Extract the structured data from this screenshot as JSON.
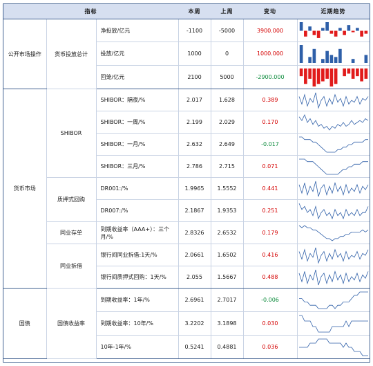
{
  "header": {
    "indicator": "指标",
    "this_week": "本周",
    "last_week": "上周",
    "change": "变动",
    "trend": "近期趋势"
  },
  "groups": [
    {
      "name": "公开市场操作",
      "subgroups": [
        {
          "name": "货币投放总计",
          "rows": [
            0,
            1,
            2
          ]
        }
      ]
    },
    {
      "name": "货币市场",
      "subgroups": [
        {
          "name": "SHIBOR",
          "rows": [
            3,
            4,
            5,
            6
          ]
        },
        {
          "name": "质押式回购",
          "rows": [
            7,
            8
          ]
        },
        {
          "name": "同业存单",
          "rows": [
            9
          ]
        },
        {
          "name": "同业拆借",
          "rows": [
            10,
            11
          ]
        }
      ]
    },
    {
      "name": "国债",
      "subgroups": [
        {
          "name": "国债收益率",
          "rows": [
            12,
            13,
            14
          ]
        }
      ]
    }
  ],
  "rows": [
    {
      "indicator": "净投放/亿元",
      "this_week": "-1100",
      "last_week": "-5000",
      "change": "3900.000",
      "sign": "pos",
      "trend_type": "bar",
      "trend": [
        6,
        -4,
        3,
        -3,
        -5,
        2,
        6,
        -2,
        -4,
        2,
        -3,
        4,
        -1,
        2,
        -4,
        -2
      ]
    },
    {
      "indicator": "投放/亿元",
      "this_week": "1000",
      "last_week": "0",
      "change": "1000.000",
      "sign": "pos",
      "trend_type": "bar",
      "trend": [
        9,
        0,
        3,
        7,
        0,
        2,
        6,
        4,
        3,
        7,
        0,
        0,
        2,
        0,
        0,
        4
      ]
    },
    {
      "indicator": "回笼/亿元",
      "this_week": "2100",
      "last_week": "5000",
      "change": "-2900.000",
      "sign": "neg",
      "trend_type": "bar",
      "trend": [
        -3,
        -6,
        -4,
        -7,
        -6,
        -5,
        -4,
        -7,
        -6,
        0,
        -3,
        -2,
        -4,
        -3,
        -5,
        -4
      ]
    },
    {
      "indicator": "SHIBOR：隔夜/%",
      "this_week": "2.017",
      "last_week": "1.628",
      "change": "0.389",
      "sign": "pos",
      "trend_type": "line",
      "trend": [
        2.0,
        1.6,
        2.1,
        1.5,
        1.9,
        1.7,
        2.2,
        1.4,
        1.8,
        2.0,
        1.5,
        1.9,
        1.6,
        2.1,
        1.7,
        1.9,
        1.5,
        2.0,
        1.6,
        1.8,
        1.7,
        2.0,
        1.6,
        1.9,
        1.8,
        2.0
      ]
    },
    {
      "indicator": "SHIBOR：一周/%",
      "this_week": "2.199",
      "last_week": "2.029",
      "change": "0.170",
      "sign": "pos",
      "trend_type": "line",
      "trend": [
        2.3,
        2.1,
        2.4,
        2.0,
        2.2,
        1.9,
        2.1,
        1.8,
        1.9,
        1.7,
        1.8,
        1.6,
        1.8,
        1.7,
        1.9,
        1.8,
        2.0,
        1.8,
        1.9,
        2.1,
        1.9,
        2.0,
        2.1,
        2.0,
        2.2,
        2.1
      ]
    },
    {
      "indicator": "SHIBOR：一月/%",
      "this_week": "2.632",
      "last_week": "2.649",
      "change": "-0.017",
      "sign": "neg",
      "trend_type": "line",
      "trend": [
        2.8,
        2.8,
        2.7,
        2.7,
        2.7,
        2.6,
        2.6,
        2.5,
        2.4,
        2.3,
        2.2,
        2.2,
        2.2,
        2.2,
        2.3,
        2.3,
        2.4,
        2.4,
        2.5,
        2.5,
        2.6,
        2.6,
        2.6,
        2.6,
        2.7,
        2.7
      ]
    },
    {
      "indicator": "SHIBOR：三月/%",
      "this_week": "2.786",
      "last_week": "2.715",
      "change": "0.071",
      "sign": "pos",
      "trend_type": "line",
      "trend": [
        2.9,
        2.9,
        2.9,
        2.8,
        2.8,
        2.8,
        2.7,
        2.6,
        2.5,
        2.4,
        2.3,
        2.3,
        2.3,
        2.3,
        2.3,
        2.4,
        2.5,
        2.5,
        2.6,
        2.6,
        2.7,
        2.7,
        2.7,
        2.8,
        2.8,
        2.8
      ]
    },
    {
      "indicator": "DR001:/%",
      "this_week": "1.9965",
      "last_week": "1.5552",
      "change": "0.441",
      "sign": "pos",
      "trend_type": "line",
      "trend": [
        2.0,
        1.5,
        2.1,
        1.4,
        1.9,
        1.6,
        2.2,
        1.3,
        1.8,
        2.0,
        1.4,
        1.9,
        1.5,
        2.1,
        1.6,
        1.9,
        1.4,
        2.0,
        1.5,
        1.8,
        1.6,
        2.0,
        1.5,
        1.9,
        1.7,
        2.0
      ]
    },
    {
      "indicator": "DR007:/%",
      "this_week": "2.1867",
      "last_week": "1.9353",
      "change": "0.251",
      "sign": "pos",
      "trend_type": "line",
      "trend": [
        2.3,
        2.1,
        2.2,
        2.0,
        2.1,
        1.9,
        2.2,
        1.8,
        2.0,
        2.1,
        1.9,
        2.0,
        1.8,
        2.1,
        1.9,
        2.0,
        1.8,
        2.1,
        1.9,
        2.0,
        1.9,
        2.1,
        1.9,
        2.0,
        2.0,
        2.2
      ]
    },
    {
      "indicator": "到期收益率（AAA+）：三个月/%",
      "this_week": "2.8326",
      "last_week": "2.6532",
      "change": "0.179",
      "sign": "pos",
      "trend_type": "line",
      "trend": [
        3.0,
        2.9,
        3.0,
        2.9,
        2.9,
        2.8,
        2.8,
        2.7,
        2.6,
        2.5,
        2.4,
        2.4,
        2.3,
        2.4,
        2.4,
        2.5,
        2.5,
        2.6,
        2.6,
        2.7,
        2.7,
        2.7,
        2.7,
        2.8,
        2.7,
        2.8
      ]
    },
    {
      "indicator": "银行间同业拆借:1天/%",
      "this_week": "2.0661",
      "last_week": "1.6502",
      "change": "0.416",
      "sign": "pos",
      "trend_type": "line",
      "trend": [
        2.0,
        1.6,
        2.1,
        1.5,
        1.9,
        1.7,
        2.2,
        1.4,
        1.8,
        2.0,
        1.5,
        1.9,
        1.6,
        2.1,
        1.7,
        1.9,
        1.5,
        2.0,
        1.6,
        1.8,
        1.7,
        2.0,
        1.6,
        1.9,
        1.8,
        2.1
      ]
    },
    {
      "indicator": "银行间质押式回购：1天/%",
      "this_week": "2.055",
      "last_week": "1.5667",
      "change": "0.488",
      "sign": "pos",
      "trend_type": "line",
      "trend": [
        2.0,
        1.5,
        2.1,
        1.4,
        1.9,
        1.6,
        2.2,
        1.3,
        1.8,
        2.0,
        1.4,
        1.9,
        1.5,
        2.1,
        1.6,
        1.9,
        1.4,
        2.0,
        1.5,
        1.8,
        1.6,
        2.0,
        1.5,
        1.9,
        1.7,
        2.1
      ]
    },
    {
      "indicator": "到期收益率：1年/%",
      "this_week": "2.6961",
      "last_week": "2.7017",
      "change": "-0.006",
      "sign": "neg",
      "trend_type": "line",
      "trend": [
        2.5,
        2.5,
        2.4,
        2.4,
        2.3,
        2.3,
        2.3,
        2.2,
        2.2,
        2.2,
        2.2,
        2.3,
        2.3,
        2.2,
        2.3,
        2.3,
        2.4,
        2.4,
        2.4,
        2.5,
        2.6,
        2.6,
        2.7,
        2.7,
        2.7,
        2.7
      ]
    },
    {
      "indicator": "到期收益率：10年/%",
      "this_week": "3.2202",
      "last_week": "3.1898",
      "change": "0.030",
      "sign": "pos",
      "trend_type": "line",
      "trend": [
        3.3,
        3.3,
        3.2,
        3.2,
        3.2,
        3.1,
        3.1,
        3.0,
        3.0,
        3.0,
        3.0,
        3.0,
        3.1,
        3.1,
        3.1,
        3.1,
        3.1,
        3.2,
        3.1,
        3.2,
        3.2,
        3.2,
        3.2,
        3.2,
        3.2,
        3.2
      ]
    },
    {
      "indicator": "10年-1年/%",
      "this_week": "0.5241",
      "last_week": "0.4881",
      "change": "0.036",
      "sign": "pos",
      "trend_type": "line",
      "trend": [
        0.7,
        0.7,
        0.7,
        0.7,
        0.8,
        0.8,
        0.8,
        0.9,
        0.9,
        0.9,
        0.9,
        0.8,
        0.8,
        0.8,
        0.8,
        0.8,
        0.7,
        0.8,
        0.7,
        0.7,
        0.6,
        0.6,
        0.6,
        0.5,
        0.5,
        0.5
      ]
    }
  ],
  "colors": {
    "bar_up": "#2e5fa8",
    "bar_down": "#e11b1b",
    "line": "#2e5fa8",
    "positive_text": "#d40000",
    "negative_text": "#0a8a3a"
  }
}
